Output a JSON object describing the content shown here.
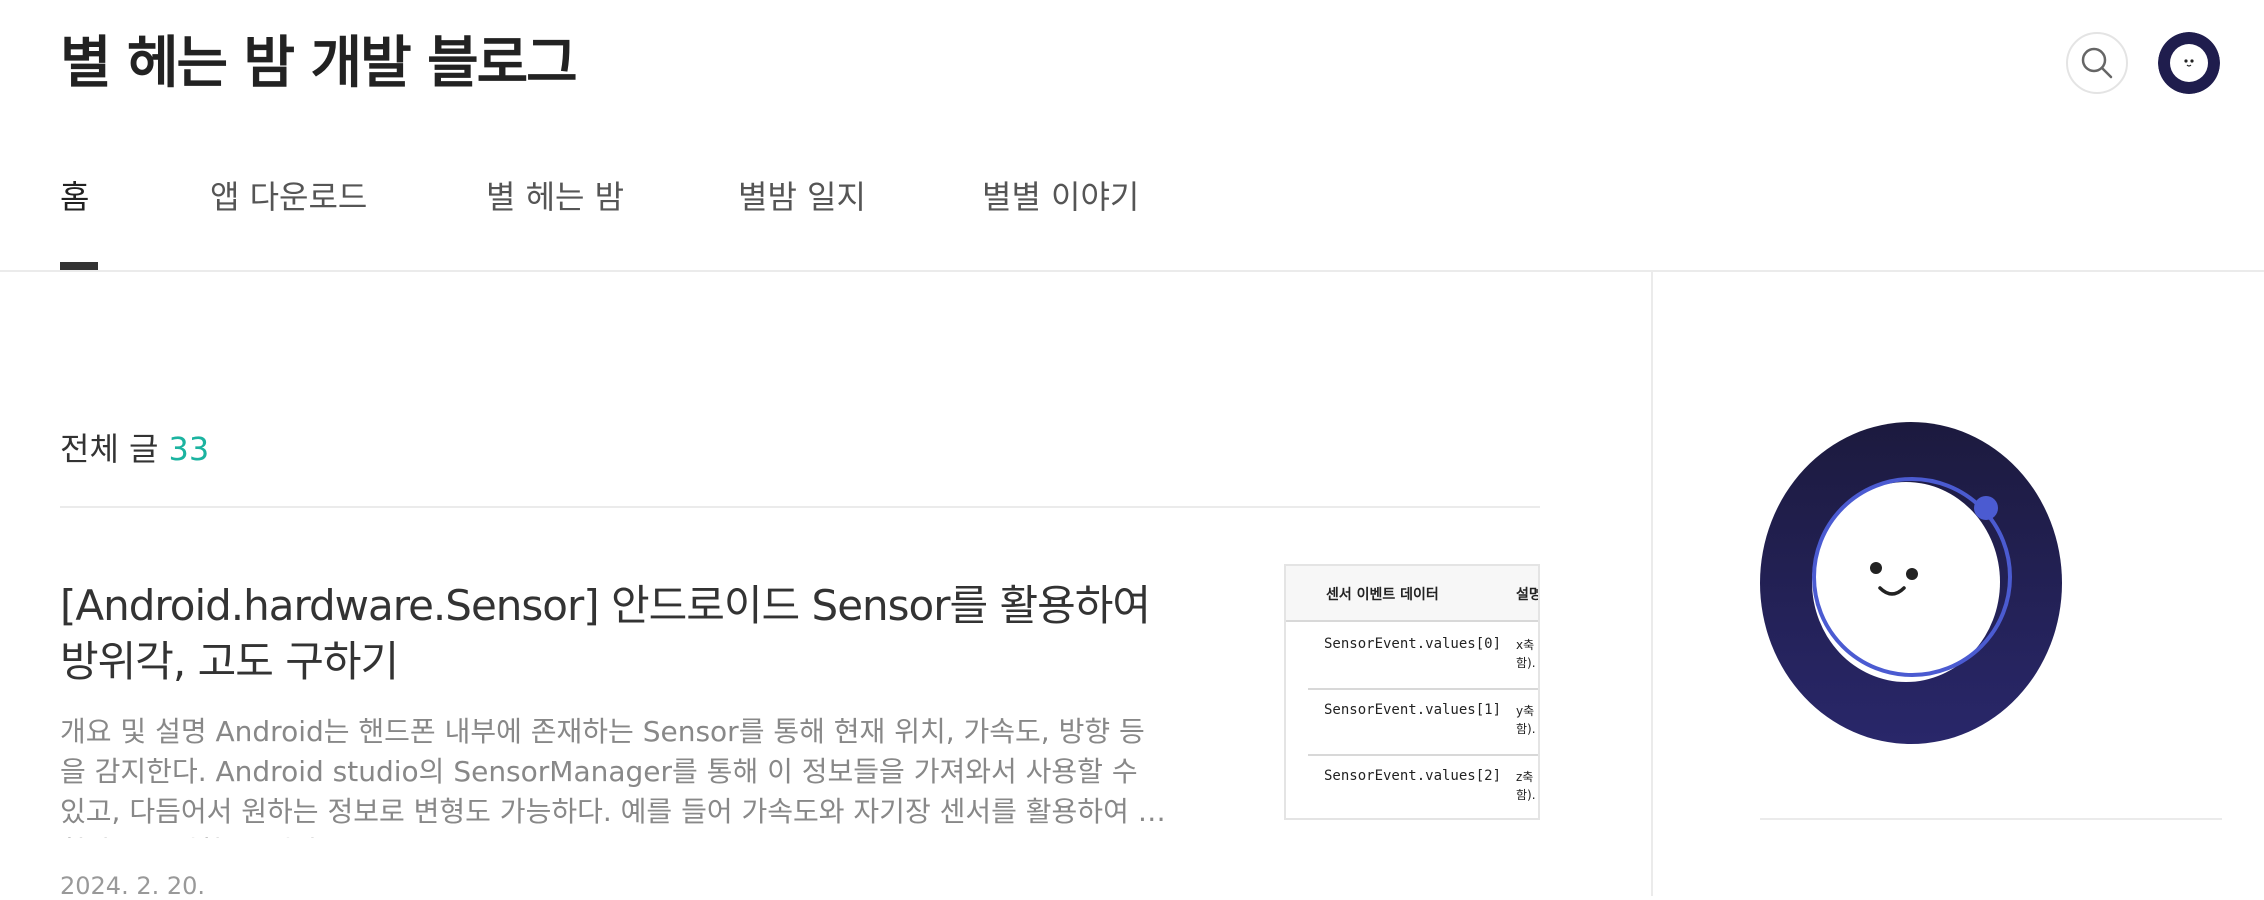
{
  "blog": {
    "title": "별 헤는 밤 개발 블로그"
  },
  "header": {
    "search_icon": "search-icon",
    "avatar_icon": "avatar"
  },
  "nav": {
    "items": [
      {
        "label": "홈",
        "active": true
      },
      {
        "label": "앱 다운로드",
        "active": false
      },
      {
        "label": "별 헤는 밤",
        "active": false
      },
      {
        "label": "별밤 일지",
        "active": false
      },
      {
        "label": "별별 이야기",
        "active": false
      }
    ]
  },
  "list": {
    "label": "전체 글",
    "count": "33"
  },
  "post": {
    "title": "[Android.hardware.Sensor] 안드로이드 Sensor를 활용하여 방위각, 고도 구하기",
    "summary": "개요 및 설명 Android는 핸드폰 내부에 존재하는 Sensor를 통해 현재 위치, 가속도, 방향 등을 감지한다. Android studio의 SensorManager를 통해 이 정보들을 가져와서 사용할 수 있고, 다듬어서 원하는 정보로 변형도 가능하다. 예를 들어 가속도와 자기장 센서를 활용하여 나침반을 구현할 수 있다.",
    "date": "2024. 2. 20.",
    "thumbnail": {
      "header_col1": "센서 이벤트 데이터",
      "header_col2": "설명",
      "rows": [
        {
          "name": "SensorEvent.values[0]",
          "desc1": "x축",
          "desc2": "함)."
        },
        {
          "name": "SensorEvent.values[1]",
          "desc1": "y축",
          "desc2": "함)."
        },
        {
          "name": "SensorEvent.values[2]",
          "desc1": "z축",
          "desc2": "함)."
        }
      ]
    }
  },
  "colors": {
    "accent": "#1bb3a0",
    "profile_dark": "#1f1d4d",
    "profile_ring": "#4b5bd1"
  }
}
